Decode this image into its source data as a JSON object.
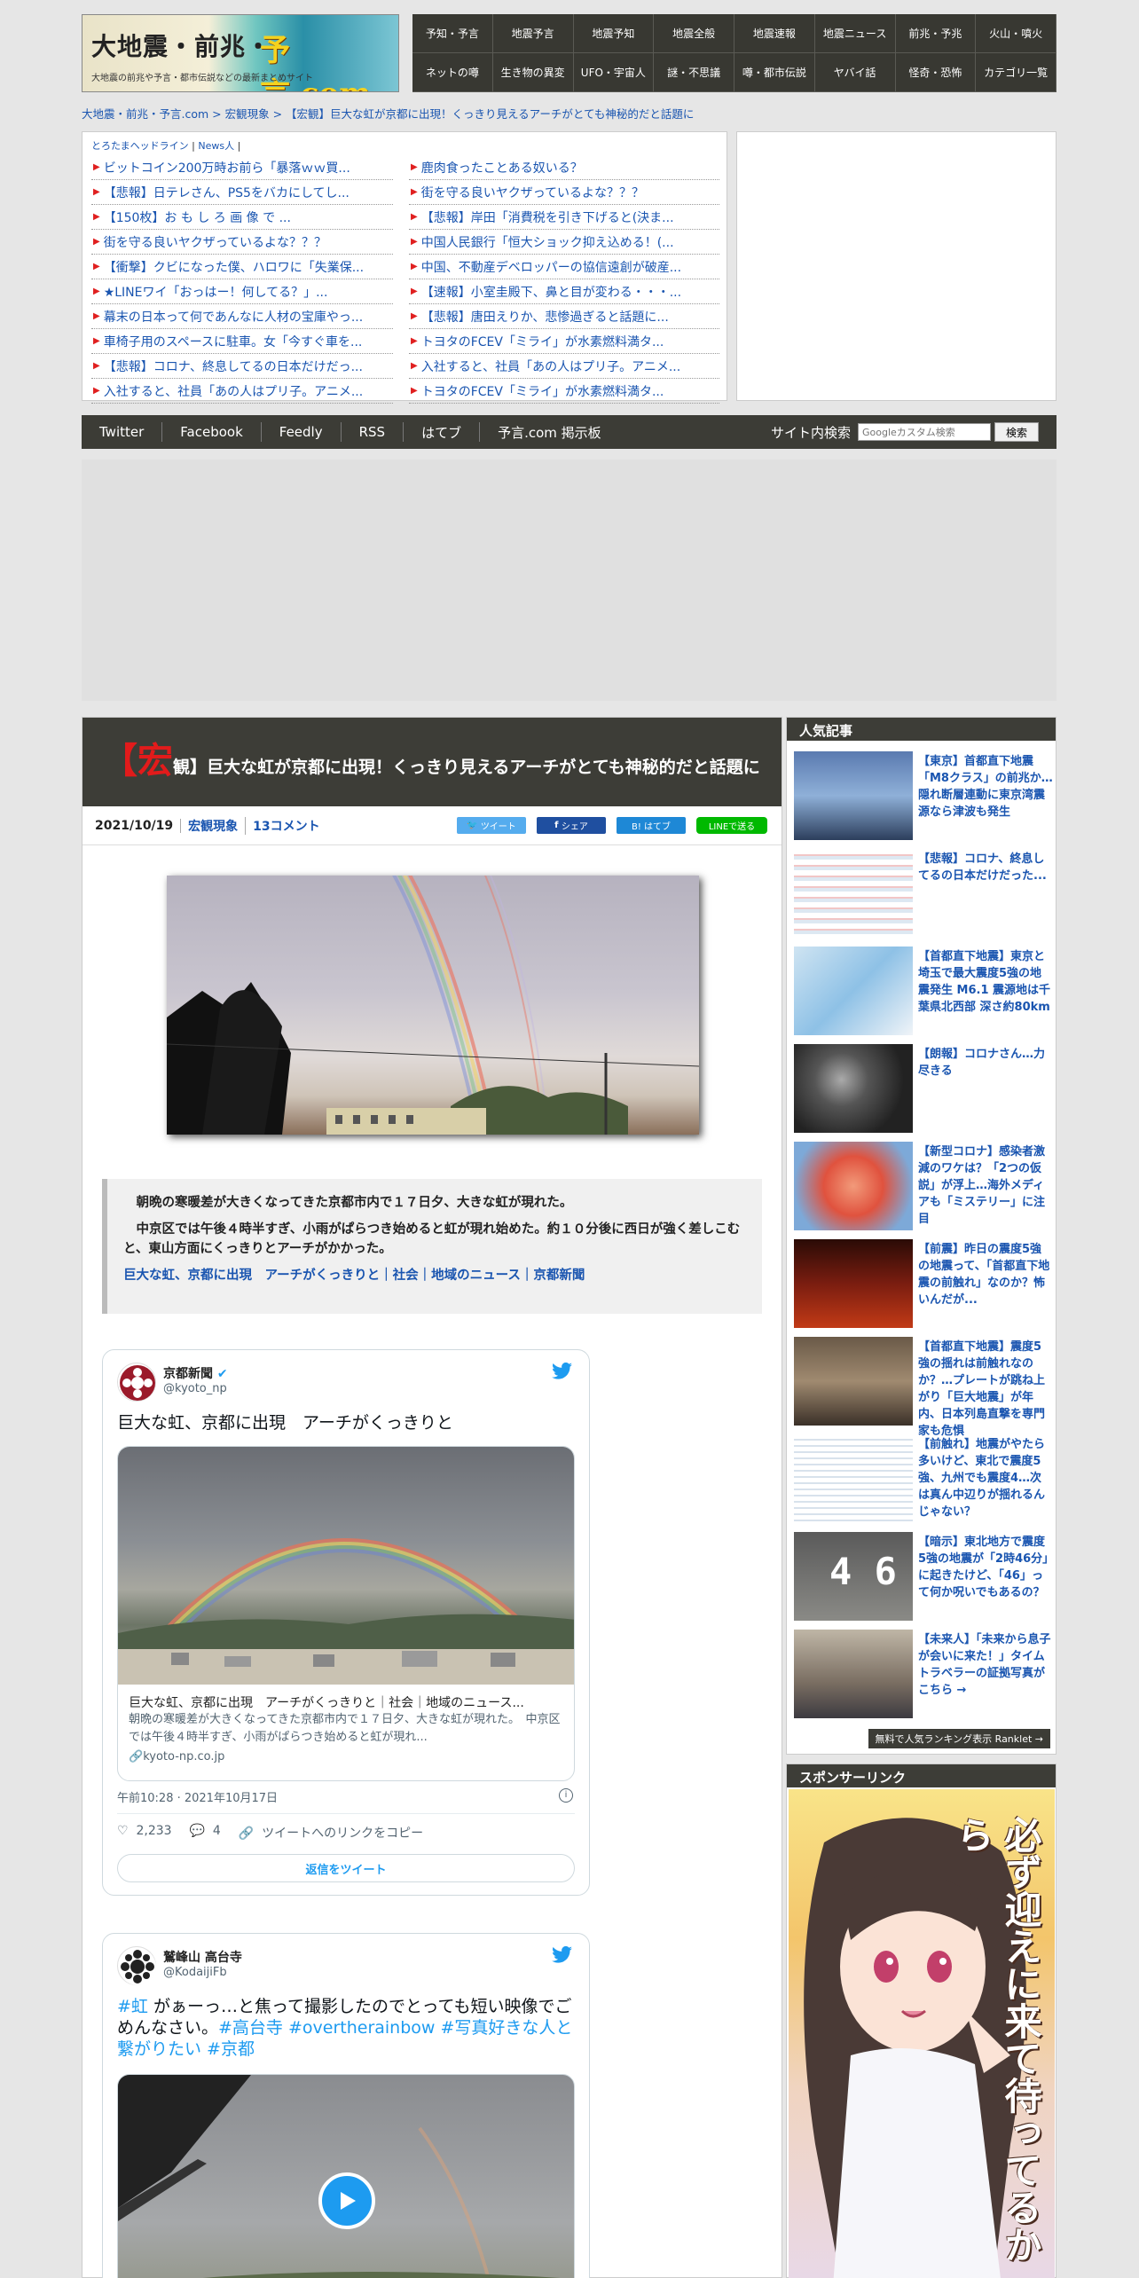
{
  "header": {
    "logo_text": "大地震・前兆・",
    "logo_text2": "予言.com",
    "logo_sub": "大地震の前兆や予言・都市伝説などの最新まとめサイト"
  },
  "nav": [
    "予知・予言",
    "地震予言",
    "地震予知",
    "地震全般",
    "地震速報",
    "地震ニュース",
    "前兆・予兆",
    "火山・噴火",
    "ネットの噂",
    "生き物の異変",
    "UFO・宇宙人",
    "謎・不思議",
    "噂・都市伝説",
    "ヤバイ話",
    "怪奇・恐怖",
    "カテゴリ一覧"
  ],
  "breadcrumb": "大地震・前兆・予言.com > 宏観現象 > 【宏観】巨大な虹が京都に出現！くっきり見えるアーチがとても神秘的だと話題に",
  "links_header": {
    "a": "とろたまヘッドライン",
    "sep": " | ",
    "b": "News人",
    "sep2": " |"
  },
  "links_left": [
    "ビットコイン200万時お前ら「暴落ｗｗ買...",
    "【悲報】日テレさん、PS5をバカにしてし...",
    "【150枚】お も し ろ 画 像 で ...",
    "街を守る良いヤクザっているよな？？？",
    "【衝撃】クビになった僕、ハロワに「失業保...",
    "★LINEワイ「おっはー！何してる？」...",
    "幕末の日本って何であんなに人材の宝庫やっ...",
    "車椅子用のスペースに駐車。女「今すぐ車を...",
    "【悲報】コロナ、終息してるの日本だけだっ...",
    "入社すると、社員「あの人はプリ子。アニメ..."
  ],
  "links_right": [
    "鹿肉食ったことある奴いる？",
    "街を守る良いヤクザっているよな？？？",
    "【悲報】岸田「消費税を引き下げると(決ま...",
    "中国人民銀行「恒大ショック抑え込める！(...",
    "中国、不動産デベロッパーの協信遠創が破産...",
    "【速報】小室圭殿下、鼻と目が変わる・・・...",
    "【悲報】唐田えりか、悲惨過ぎると話題に...",
    "トヨタのFCEV「ミライ」が水素燃料満タ...",
    "入社すると、社員「あの人はプリ子。アニメ...",
    "トヨタのFCEV「ミライ」が水素燃料満タ..."
  ],
  "socialbar": {
    "items": [
      "Twitter",
      "Facebook",
      "Feedly",
      "RSS",
      "はてブ",
      "予言.com 掲示板"
    ],
    "search_label": "サイト内検索",
    "search_placeholder": "Googleカスタム検索",
    "search_button": "検索"
  },
  "article": {
    "title_big": "【宏",
    "title_rest": "観】巨大な虹が京都に出現！くっきり見えるアーチがとても神秘的だと話題に",
    "date": "2021/10/19",
    "category": "宏観現象",
    "comments": "13コメント",
    "share": {
      "tweet": "ツイート",
      "fb": "シェア",
      "hatebu": "B! はてブ",
      "line": "LINEで送る"
    },
    "quote_p1": "朝晩の寒暖差が大きくなってきた京都市内で１７日夕、大きな虹が現れた。",
    "quote_p2": "中京区では午後４時半すぎ、小雨がぱらつき始めると虹が現れ始めた。約１０分後に西日が強く差しこむと、東山方面にくっきりとアーチがかかった。",
    "quote_link": "巨大な虹、京都に出現　アーチがくっきりと｜社会｜地域のニュース｜京都新聞"
  },
  "tweet1": {
    "name": "京都新聞",
    "handle": "@kyoto_np",
    "text": "巨大な虹、京都に出現　アーチがくっきりと",
    "card_title": "巨大な虹、京都に出現　アーチがくっきりと｜社会｜地域のニュース...",
    "card_desc": "朝晩の寒暖差が大きくなってきた京都市内で１７日夕、大きな虹が現れた。　中京区では午後４時半すぎ、小雨がぱらつき始めると虹が現れ...",
    "card_domain": "kyoto-np.co.jp",
    "time": "午前10:28 · 2021年10月17日",
    "likes": "2,233",
    "replies": "4",
    "copy_link": "ツイートへのリンクをコピー",
    "reply_btn": "返信をツイート"
  },
  "tweet2": {
    "name": "鷲峰山 高台寺",
    "handle": "@KodaijiFb",
    "text_a": "#虹",
    "text_b": " がぁーっ…と焦って撮影したのでとっても短い映像でごめんなさい。",
    "text_c": "#高台寺 #overtherainbow #写真好きな人と繋がりたい #京都"
  },
  "popular": {
    "heading": "人気記事",
    "items": [
      "【東京】首都直下地震「M8クラス」の前兆か…隠れ断層連動に東京湾震源なら津波も発生",
      "【悲報】コロナ、終息してるの日本だけだった...",
      "【首都直下地震】東京と埼玉で最大震度5強の地震発生 M6.1 震源地は千葉県北西部 深さ約80km",
      "【朗報】コロナさん…力尽きる",
      "【新型コロナ】感染者激減のワケは？「2つの仮説」が浮上…海外メディアも「ミステリー」に注目",
      "【前震】昨日の震度5強の地震って、「首都直下地震の前触れ」なのか？怖いんだが...",
      "【首都直下地震】震度5強の揺れは前触れなのか？…プレートが跳ね上がり「巨大地震」が年内、日本列島直撃を専門家も危惧",
      "【前触れ】地震がやたら多いけど、東北で震度5強、九州でも震度4…次は真ん中辺りが揺れるんじゃない？",
      "【暗示】東北地方で震度5強の地震が「2時46分」に起きたけど、「46」って何か呪いでもあるの？",
      "【未来人】「未来から息子が会いに来た！」タイムトラベラーの証拠写真がこちら →"
    ],
    "rank_btn": "無料で人気ランキング表示 Ranklet →"
  },
  "sponsor": {
    "heading": "スポンサーリンク",
    "ad_text": "必ず迎えに来て待ってるから"
  },
  "colors": {
    "nav_bg": "#383832",
    "accent_red": "#e21b1b",
    "link": "#1a55b0",
    "twitter": "#1d9bf0"
  }
}
